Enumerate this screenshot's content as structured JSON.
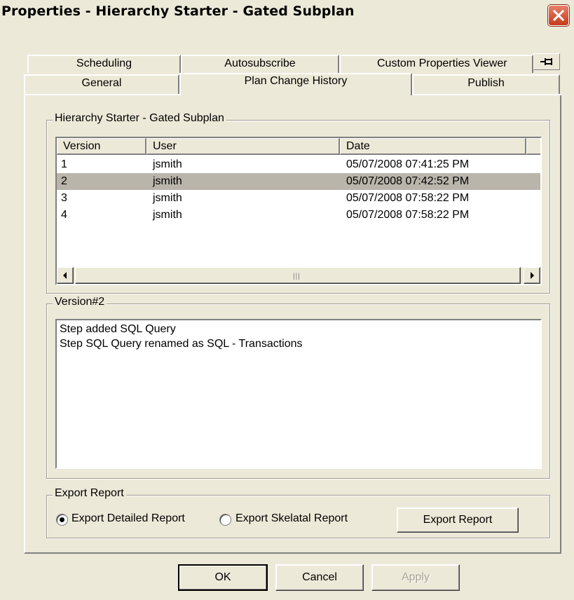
{
  "window": {
    "title": "Properties - Hierarchy Starter - Gated Subplan"
  },
  "tabs": {
    "row1": [
      "Scheduling",
      "Autosubscribe",
      "Custom Properties Viewer"
    ],
    "row2": [
      "General",
      "Plan Change History",
      "Publish"
    ],
    "active": "Plan Change History"
  },
  "history_group": {
    "label": "Hierarchy Starter - Gated Subplan",
    "columns": [
      "Version",
      "User",
      "Date"
    ],
    "rows": [
      {
        "version": "1",
        "user": "jsmith",
        "date": "05/07/2008 07:41:25 PM",
        "selected": false
      },
      {
        "version": "2",
        "user": "jsmith",
        "date": "05/07/2008 07:42:52 PM",
        "selected": true
      },
      {
        "version": "3",
        "user": "jsmith",
        "date": "05/07/2008 07:58:22 PM",
        "selected": false
      },
      {
        "version": "4",
        "user": "jsmith",
        "date": "05/07/2008 07:58:22 PM",
        "selected": false
      }
    ]
  },
  "version_group": {
    "label": "Version#2",
    "lines": [
      "Step added SQL Query",
      "Step SQL Query renamed as SQL - Transactions"
    ]
  },
  "export_group": {
    "label": "Export Report",
    "options": [
      "Export Detailed Report",
      "Export Skelatal Report"
    ],
    "selected": "Export Detailed Report",
    "button": "Export Report"
  },
  "buttons": {
    "ok": "OK",
    "cancel": "Cancel",
    "apply": "Apply"
  },
  "icons": [
    "close-icon",
    "pin-icon",
    "scroll-left-icon",
    "scroll-right-icon"
  ],
  "colors": {
    "selection": "#b9b5ab",
    "close_button": "#d14f31",
    "face": "#ece9d8"
  }
}
